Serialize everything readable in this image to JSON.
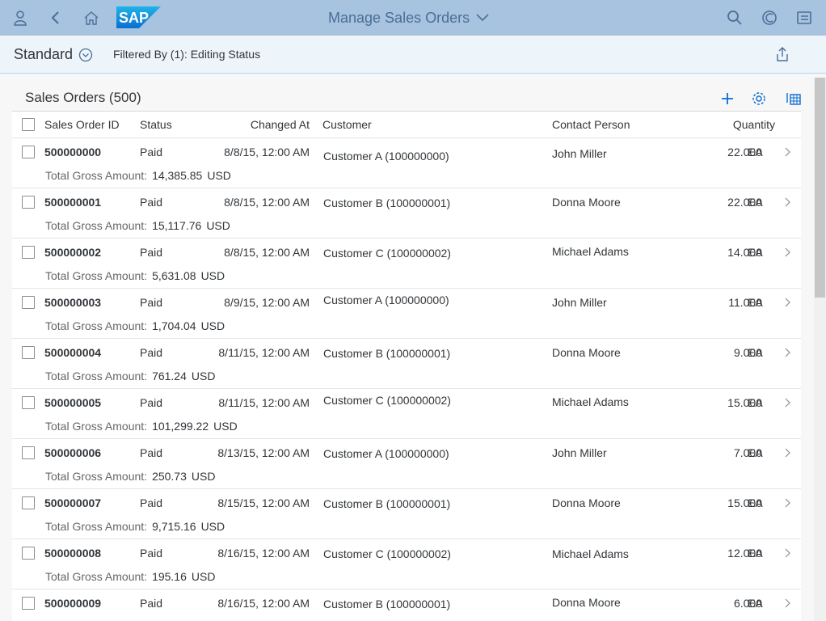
{
  "shell": {
    "app_title": "Manage Sales Orders",
    "logo_text": "SAP",
    "icons": [
      "user-icon",
      "back-icon",
      "home-icon",
      "search-icon",
      "copilot-icon",
      "notifications-icon"
    ]
  },
  "subheader": {
    "variant": "Standard",
    "filter_text": "Filtered By (1): Editing Status"
  },
  "list": {
    "title": "Sales Orders (500)",
    "columns": {
      "id": "Sales Order ID",
      "status": "Status",
      "changed": "Changed At",
      "customer": "Customer",
      "contact": "Contact Person",
      "quantity": "Quantity"
    },
    "gross_label": "Total Gross Amount:",
    "rows": [
      {
        "id": "500000000",
        "status": "Paid",
        "changed": "8/8/15, 12:00 AM",
        "customer": "Customer A (100000000)",
        "contact": "John Miller",
        "quantity": "22.000",
        "unit": "EA",
        "amount": "14,385.85",
        "currency": "USD"
      },
      {
        "id": "500000001",
        "status": "Paid",
        "changed": "8/8/15, 12:00 AM",
        "customer": "Customer B (100000001)",
        "contact": "Donna Moore",
        "quantity": "22.000",
        "unit": "EA",
        "amount": "15,117.76",
        "currency": "USD"
      },
      {
        "id": "500000002",
        "status": "Paid",
        "changed": "8/8/15, 12:00 AM",
        "customer": "Customer C (100000002)",
        "contact": "Michael Adams",
        "quantity": "14.000",
        "unit": "EA",
        "amount": "5,631.08",
        "currency": "USD"
      },
      {
        "id": "500000003",
        "status": "Paid",
        "changed": "8/9/15, 12:00 AM",
        "customer": "Customer A (100000000)",
        "contact": "John Miller",
        "quantity": "11.000",
        "unit": "EA",
        "amount": "1,704.04",
        "currency": "USD"
      },
      {
        "id": "500000004",
        "status": "Paid",
        "changed": "8/11/15, 12:00 AM",
        "customer": "Customer B (100000001)",
        "contact": "Donna Moore",
        "quantity": "9.000",
        "unit": "EA",
        "amount": "761.24",
        "currency": "USD"
      },
      {
        "id": "500000005",
        "status": "Paid",
        "changed": "8/11/15, 12:00 AM",
        "customer": "Customer C (100000002)",
        "contact": "Michael Adams",
        "quantity": "15.000",
        "unit": "EA",
        "amount": "101,299.22",
        "currency": "USD"
      },
      {
        "id": "500000006",
        "status": "Paid",
        "changed": "8/13/15, 12:00 AM",
        "customer": "Customer A (100000000)",
        "contact": "John Miller",
        "quantity": "7.000",
        "unit": "EA",
        "amount": "250.73",
        "currency": "USD"
      },
      {
        "id": "500000007",
        "status": "Paid",
        "changed": "8/15/15, 12:00 AM",
        "customer": "Customer B (100000001)",
        "contact": "Donna Moore",
        "quantity": "15.000",
        "unit": "EA",
        "amount": "9,715.16",
        "currency": "USD"
      },
      {
        "id": "500000008",
        "status": "Paid",
        "changed": "8/16/15, 12:00 AM",
        "customer": "Customer C (100000002)",
        "contact": "Michael Adams",
        "quantity": "12.000",
        "unit": "EA",
        "amount": "195.16",
        "currency": "USD"
      },
      {
        "id": "500000009",
        "status": "Paid",
        "changed": "8/16/15, 12:00 AM",
        "customer": "Customer B (100000001)",
        "contact": "Donna Moore",
        "quantity": "6.000",
        "unit": "EA",
        "amount": "",
        "currency": ""
      }
    ]
  },
  "colors": {
    "shell_bg": "#a8c3df",
    "title_blue": "#4a6e98",
    "icon_blue": "#0a6ed1",
    "logo_blue": "#0a8fd8"
  }
}
